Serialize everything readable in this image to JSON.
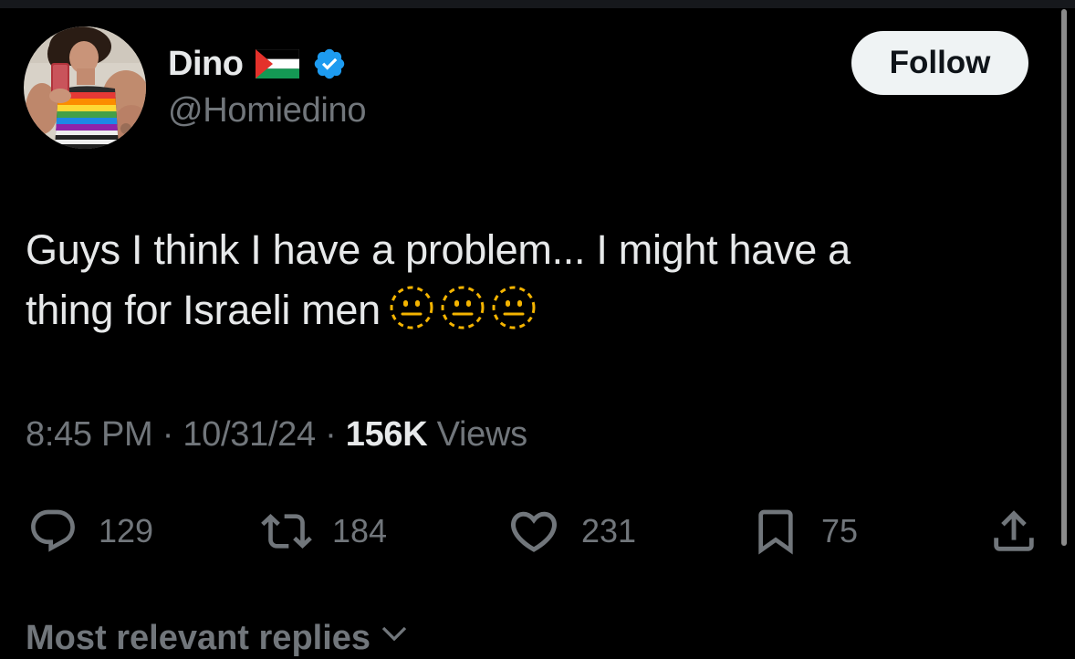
{
  "author": {
    "display_name": "Dino",
    "handle": "@Homiedino"
  },
  "follow_label": "Follow",
  "tweet": {
    "line1": "Guys I think I have a problem... I might have a",
    "line2": "thing for Israeli men",
    "emojis": [
      "dotted-line-face",
      "dotted-line-face",
      "dotted-line-face"
    ]
  },
  "meta": {
    "time": "8:45 PM",
    "separator": "·",
    "date": "10/31/24",
    "views_count": "156K",
    "views_label": "Views"
  },
  "actions": {
    "replies": "129",
    "reposts": "184",
    "likes": "231",
    "bookmarks": "75"
  },
  "replies_sort": {
    "label": "Most relevant replies"
  },
  "icons": {
    "reply": "reply-icon",
    "repost": "repost-icon",
    "like": "heart-icon",
    "bookmark": "bookmark-icon",
    "share": "share-icon",
    "verified": "verified-badge-icon",
    "flag": "palestine-flag-icon",
    "chevron": "chevron-down-icon"
  },
  "colors": {
    "background": "#000000",
    "text_primary": "#e7e9ea",
    "text_secondary": "#71767b",
    "verified_blue": "#1d9bf0",
    "follow_bg": "#eff3f4",
    "emoji_yellow": "#f4b400"
  }
}
